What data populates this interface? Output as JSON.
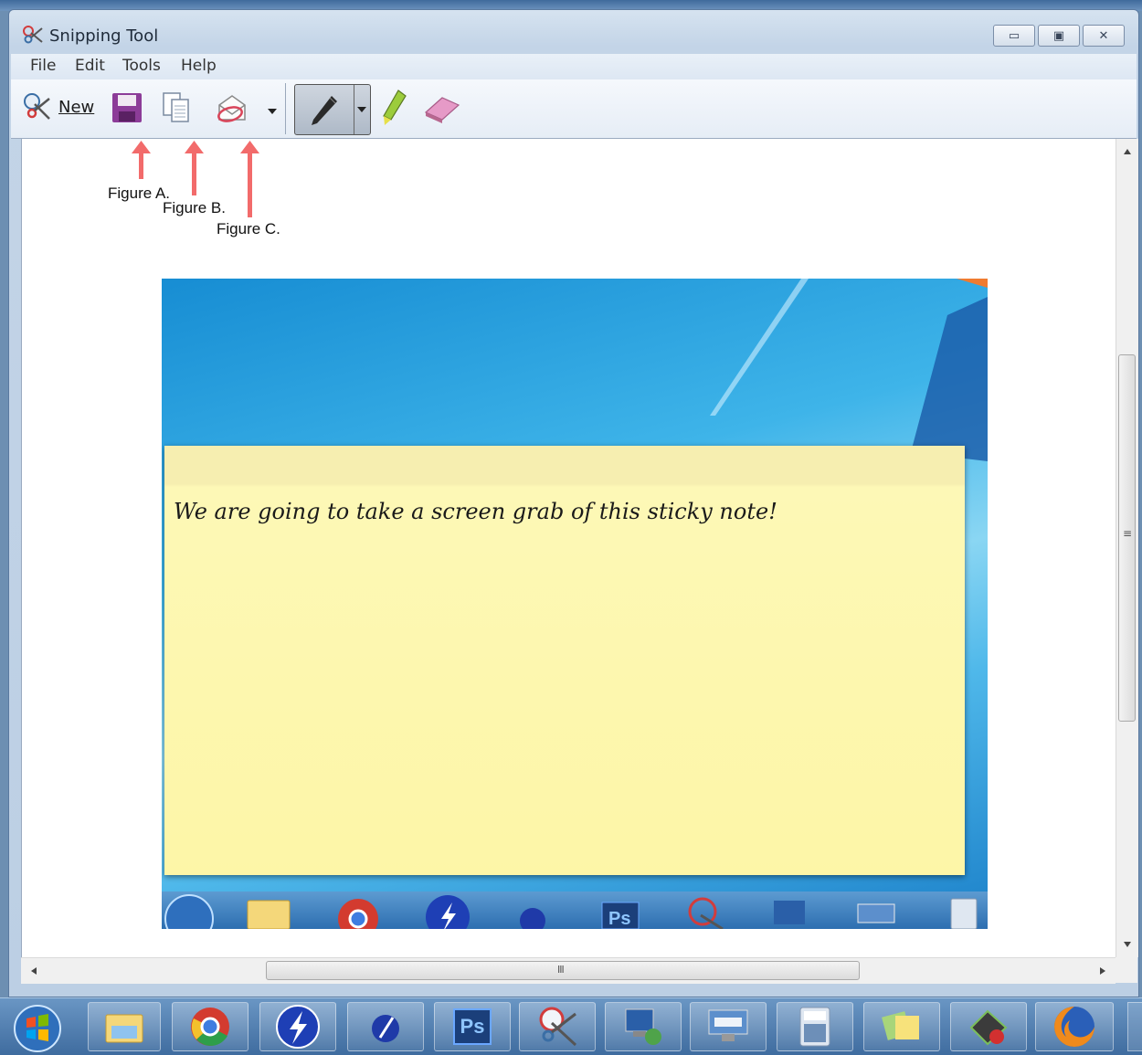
{
  "window": {
    "title": "Snipping Tool"
  },
  "menu": [
    "File",
    "Edit",
    "Tools",
    "Help"
  ],
  "toolbar": {
    "new_label": "New"
  },
  "annotations": [
    "Figure A.",
    "Figure B.",
    "Figure C."
  ],
  "snip": {
    "note_text": "We are going to take a screen grab of this sticky note!",
    "taskbar_icons": [
      "start-orb-icon",
      "explorer-icon",
      "chrome-icon",
      "bolt-app-icon",
      "pen-app-icon",
      "photoshop-icon",
      "snipping-tool-icon",
      "remote-desktop-icon",
      "keyboard-icon",
      "calculator-icon"
    ],
    "ps_label": "Ps"
  },
  "scrollbars": {
    "grip_label": "III",
    "vgrip_label": "≡"
  },
  "taskbar": {
    "icons": [
      "start-orb-icon",
      "explorer-icon",
      "chrome-icon",
      "bolt-app-icon",
      "pen-app-icon",
      "photoshop-icon",
      "snipping-tool-icon",
      "remote-desktop-icon",
      "keyboard-icon",
      "calculator-icon",
      "sticky-notes-icon",
      "media-app-icon",
      "firefox-icon"
    ],
    "ps_label": "Ps"
  },
  "colors": {
    "arrow": "#f26b6b",
    "note": "#fdf6a7",
    "accent": "#2d6eb0"
  }
}
